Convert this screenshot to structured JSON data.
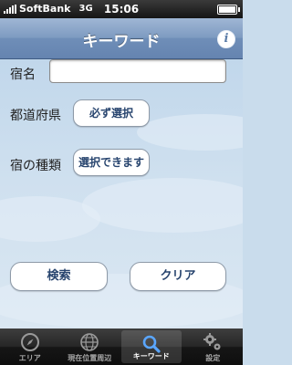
{
  "status_bar": {
    "carrier": "SoftBank",
    "network": "3G",
    "time": "15:06"
  },
  "nav": {
    "title": "キーワード",
    "info_icon": "info-icon"
  },
  "form": {
    "name_label": "宿名",
    "name_value": "",
    "prefecture_label": "都道府県",
    "prefecture_button": "必ず選択",
    "type_label": "宿の種類",
    "type_button": "選択できます",
    "search_button": "検索",
    "clear_button": "クリア"
  },
  "tabs": [
    {
      "label": "エリア",
      "icon": "compass-icon",
      "active": false
    },
    {
      "label": "現在位置周辺",
      "icon": "globe-icon",
      "active": false
    },
    {
      "label": "キーワード",
      "icon": "search-icon",
      "active": true
    },
    {
      "label": "設定",
      "icon": "gear-icon",
      "active": false
    }
  ]
}
